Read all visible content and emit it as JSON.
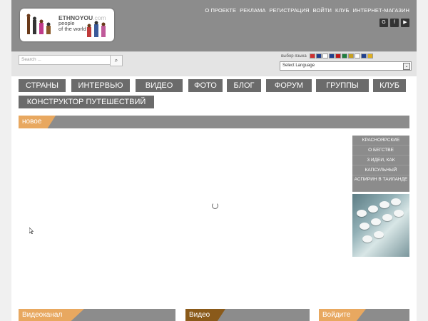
{
  "header": {
    "logo": {
      "brand_main": "ETHNOYOU",
      "brand_suffix": ".com",
      "tagline_1": "people",
      "tagline_2": "of the world"
    },
    "nav": [
      "О ПРОЕКТЕ",
      "РЕКЛАМА",
      "РЕГИСТРАЦИЯ",
      "ВОЙТИ",
      "КЛУБ",
      "ИНТЕРНЕТ-МАГАЗИН"
    ],
    "social": [
      {
        "name": "google-plus-icon",
        "glyph": "G"
      },
      {
        "name": "facebook-icon",
        "glyph": "f"
      },
      {
        "name": "youtube-icon",
        "glyph": "▶"
      }
    ]
  },
  "search": {
    "placeholder": "Search ...",
    "button_glyph": "⌕"
  },
  "language": {
    "label": "выбор языка",
    "select_value": "Select Language",
    "flags": [
      "#d03030",
      "#1f3f8f",
      "#ffffff",
      "#1f3f8f",
      "#c01818",
      "#1f7f3f",
      "#c8a020",
      "#ffffff",
      "#1f3f8f",
      "#e0b020"
    ]
  },
  "menu": [
    "СТРАНЫ",
    "ИНТЕРВЬЮ",
    "ВИДЕО",
    "ФОТО",
    "БЛОГ",
    "ФОРУМ",
    "ГРУППЫ",
    "КЛУБ",
    "КОНСТРУКТОР ПУТЕШЕСТВИЙ"
  ],
  "section": {
    "title": "новое",
    "accent": "#e8a860"
  },
  "sidebar": [
    "КРАСНОЯРСКИЕ",
    "О БЕГСТВЕ",
    "3 ИДЕИ, КАК",
    "КАПСУЛЬНЫЙ",
    "АСПИРИН В ТАИЛАНДЕ"
  ],
  "bottom": [
    {
      "title": "Видеоканал",
      "accent": "#e8a860"
    },
    {
      "title": "Видео",
      "accent": "#8a5a1a"
    },
    {
      "title": "Войдите",
      "accent": "#e8a860"
    }
  ],
  "colors": {
    "header_bg": "#8c8c8c",
    "menu_bg": "#6b6b6b",
    "page_bg": "#f0f0f0"
  }
}
